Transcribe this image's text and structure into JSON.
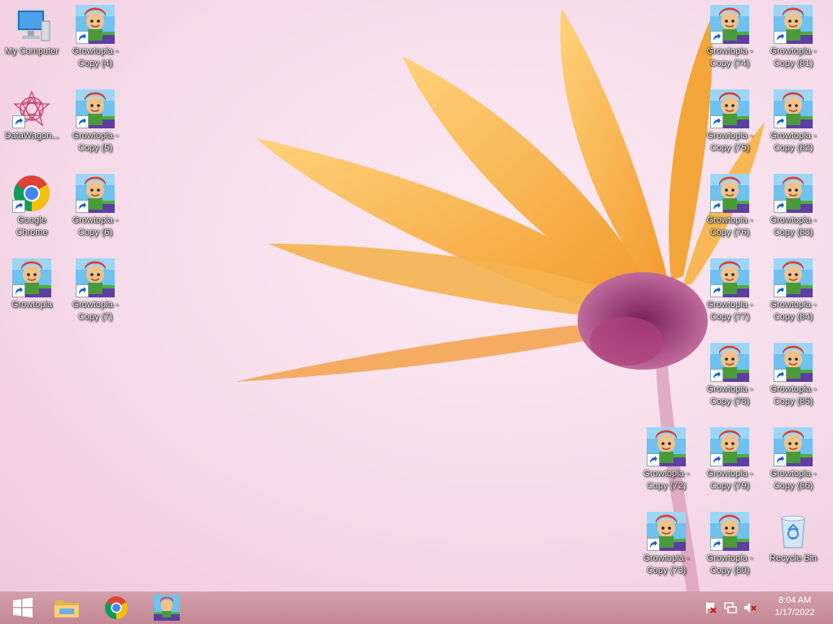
{
  "desktop": {
    "icons": [
      {
        "id": "my-computer",
        "label": "My Computer",
        "kind": "computer"
      },
      {
        "id": "growtopia-copy-4",
        "label": "Growtopia - Copy (4)",
        "kind": "growtopia"
      },
      {
        "id": "datawagon",
        "label": "DataWagon...",
        "kind": "datawagon"
      },
      {
        "id": "growtopia-copy-5",
        "label": "Growtopia - Copy (5)",
        "kind": "growtopia"
      },
      {
        "id": "google-chrome",
        "label": "Google Chrome",
        "kind": "chrome"
      },
      {
        "id": "growtopia-copy-6",
        "label": "Growtopia - Copy (6)",
        "kind": "growtopia"
      },
      {
        "id": "growtopia",
        "label": "Growtopia",
        "kind": "growtopia"
      },
      {
        "id": "growtopia-copy-7",
        "label": "Growtopia - Copy (7)",
        "kind": "growtopia"
      },
      {
        "id": "growtopia-copy-74",
        "label": "Growtopia - Copy (74)",
        "kind": "growtopia"
      },
      {
        "id": "growtopia-copy-81",
        "label": "Growtopia - Copy (81)",
        "kind": "growtopia"
      },
      {
        "id": "growtopia-copy-75",
        "label": "Growtopia - Copy (75)",
        "kind": "growtopia"
      },
      {
        "id": "growtopia-copy-82",
        "label": "Growtopia - Copy (82)",
        "kind": "growtopia"
      },
      {
        "id": "growtopia-copy-76",
        "label": "Growtopia - Copy (76)",
        "kind": "growtopia"
      },
      {
        "id": "growtopia-copy-83",
        "label": "Growtopia - Copy (83)",
        "kind": "growtopia"
      },
      {
        "id": "growtopia-copy-77",
        "label": "Growtopia - Copy (77)",
        "kind": "growtopia"
      },
      {
        "id": "growtopia-copy-84",
        "label": "Growtopia - Copy (84)",
        "kind": "growtopia"
      },
      {
        "id": "growtopia-copy-78",
        "label": "Growtopia - Copy (78)",
        "kind": "growtopia"
      },
      {
        "id": "growtopia-copy-85",
        "label": "Growtopia - Copy (85)",
        "kind": "growtopia"
      },
      {
        "id": "growtopia-copy-72",
        "label": "Growtopia - Copy (72)",
        "kind": "growtopia"
      },
      {
        "id": "growtopia-copy-79",
        "label": "Growtopia - Copy (79)",
        "kind": "growtopia"
      },
      {
        "id": "growtopia-copy-86",
        "label": "Growtopia - Copy (86)",
        "kind": "growtopia"
      },
      {
        "id": "growtopia-copy-73",
        "label": "Growtopia - Copy (73)",
        "kind": "growtopia"
      },
      {
        "id": "growtopia-copy-80",
        "label": "Growtopia - Copy (80)",
        "kind": "growtopia"
      },
      {
        "id": "recycle-bin",
        "label": "Recycle Bin",
        "kind": "recycle"
      }
    ]
  },
  "taskbar": {
    "start_icon": "windows-logo-icon",
    "pinned": [
      {
        "id": "file-explorer",
        "icon": "folder-icon"
      },
      {
        "id": "google-chrome",
        "icon": "chrome-icon"
      },
      {
        "id": "growtopia",
        "icon": "growtopia-icon"
      }
    ],
    "tray_icons": [
      "action-center-flag-icon",
      "network-icon",
      "volume-muted-icon"
    ],
    "clock": {
      "time": "8:04 AM",
      "date": "1/17/2022"
    }
  },
  "colors": {
    "taskbar": "#c98f9a",
    "wallpaper": "#f6dcea",
    "petal": "#f7a93a"
  }
}
